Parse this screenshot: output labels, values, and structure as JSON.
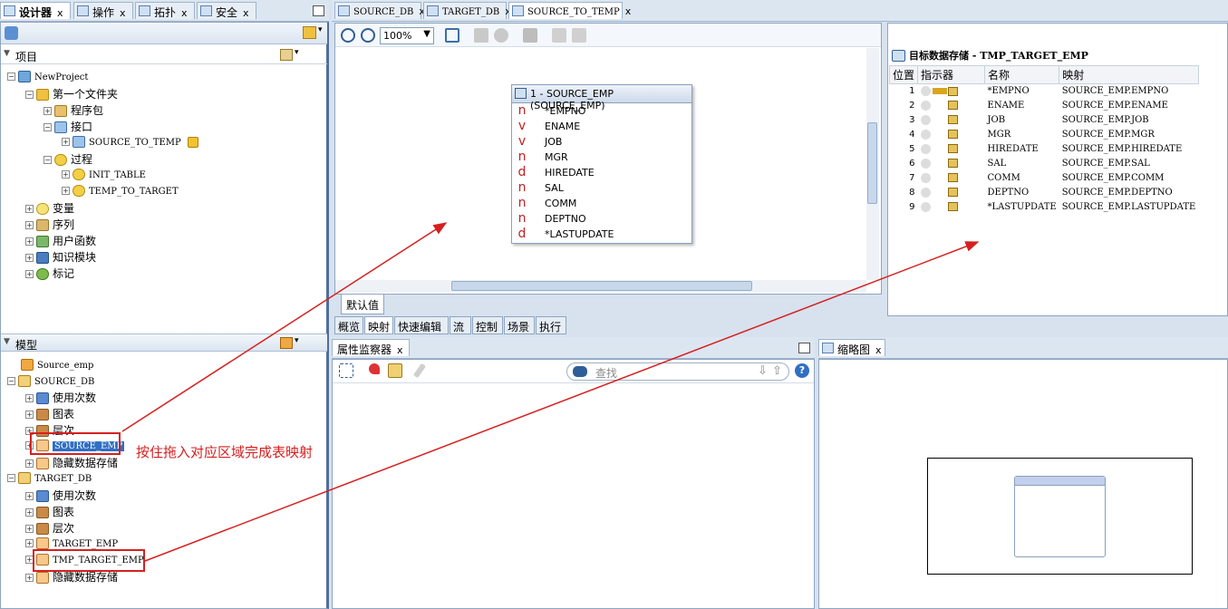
{
  "left_tabs": [
    {
      "label": "设计器",
      "icon": "designer-icon"
    },
    {
      "label": "操作",
      "icon": "operations-icon"
    },
    {
      "label": "拓扑",
      "icon": "topology-icon"
    },
    {
      "label": "安全",
      "icon": "security-icon"
    }
  ],
  "editor_tabs": [
    {
      "label": "SOURCE_DB"
    },
    {
      "label": "TARGET_DB"
    },
    {
      "label": "SOURCE_TO_TEMP"
    }
  ],
  "project": {
    "header": "项目",
    "root": "NewProject",
    "folder": "第一个文件夹",
    "packages": "程序包",
    "interfaces": "接口",
    "interface_item": "SOURCE_TO_TEMP",
    "procedures": "过程",
    "proc_1": "INIT_TABLE",
    "proc_2": "TEMP_TO_TARGET",
    "variables": "变量",
    "sequences": "序列",
    "user_functions": "用户函数",
    "knowledge_modules": "知识模块",
    "markers": "标记"
  },
  "models": {
    "header": "模型",
    "source_emp": "Source_emp",
    "source_db": "SOURCE_DB",
    "target_db": "TARGET_DB",
    "usage": "使用次数",
    "diagrams": "图表",
    "hierarchy": "层次",
    "source_emp_table": "SOURCE_EMP",
    "hidden_store": "隐藏数据存储",
    "target_emp": "TARGET_EMP",
    "tmp_target_emp": "TMP_TARGET_EMP"
  },
  "annotation": "按住拖入对应区域完成表映射",
  "zoom": "100%",
  "source_entity": {
    "title": "1 - SOURCE_EMP (SOURCE_EMP)",
    "columns": [
      {
        "type": "n",
        "name": "*EMPNO"
      },
      {
        "type": "v",
        "name": "ENAME"
      },
      {
        "type": "v",
        "name": "JOB"
      },
      {
        "type": "n",
        "name": "MGR"
      },
      {
        "type": "d",
        "name": "HIREDATE"
      },
      {
        "type": "n",
        "name": "SAL"
      },
      {
        "type": "n",
        "name": "COMM"
      },
      {
        "type": "n",
        "name": "DEPTNO"
      },
      {
        "type": "d",
        "name": "*LASTUPDATE"
      }
    ]
  },
  "default_tab": "默认值",
  "target": {
    "title": "目标数据存储 - TMP_TARGET_EMP",
    "headers": [
      "位置",
      "指示器",
      "名称",
      "映射"
    ],
    "rows": [
      {
        "pos": "1",
        "name": "*EMPNO",
        "map": "SOURCE_EMP.EMPNO"
      },
      {
        "pos": "2",
        "name": "ENAME",
        "map": "SOURCE_EMP.ENAME"
      },
      {
        "pos": "3",
        "name": "JOB",
        "map": "SOURCE_EMP.JOB"
      },
      {
        "pos": "4",
        "name": "MGR",
        "map": "SOURCE_EMP.MGR"
      },
      {
        "pos": "5",
        "name": "HIREDATE",
        "map": "SOURCE_EMP.HIREDATE"
      },
      {
        "pos": "6",
        "name": "SAL",
        "map": "SOURCE_EMP.SAL"
      },
      {
        "pos": "7",
        "name": "COMM",
        "map": "SOURCE_EMP.COMM"
      },
      {
        "pos": "8",
        "name": "DEPTNO",
        "map": "SOURCE_EMP.DEPTNO"
      },
      {
        "pos": "9",
        "name": "*LASTUPDATE",
        "map": "SOURCE_EMP.LASTUPDATE"
      }
    ]
  },
  "bottom_tabs": [
    "概览",
    "映射",
    "快速编辑",
    "流",
    "控制",
    "场景",
    "执行"
  ],
  "property_inspector": {
    "title": "属性监察器",
    "search_placeholder": "查找"
  },
  "thumbnail": {
    "title": "缩略图"
  },
  "colors": {
    "accent": "#d62020",
    "selection": "#2f6fc4"
  }
}
